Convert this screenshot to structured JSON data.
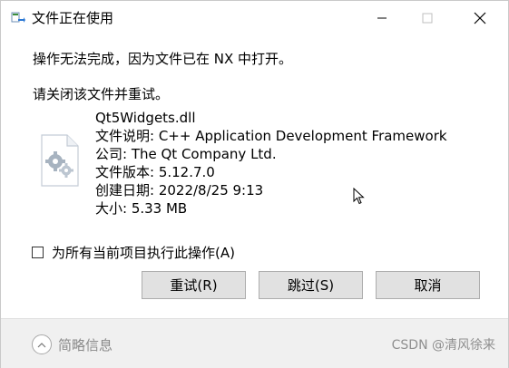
{
  "window": {
    "title": "文件正在使用"
  },
  "message": {
    "line1": "操作无法完成，因为文件已在 NX 中打开。",
    "line2": "请关闭该文件并重试。"
  },
  "file": {
    "name": "Qt5Widgets.dll",
    "description": "文件说明: C++ Application Development Framework",
    "company": "公司: The Qt Company Ltd.",
    "version": "文件版本: 5.12.7.0",
    "created": "创建日期: 2022/8/25 9:13",
    "size": "大小: 5.33 MB"
  },
  "checkbox": {
    "label": "为所有当前项目执行此操作(A)"
  },
  "buttons": {
    "retry": "重试(R)",
    "skip": "跳过(S)",
    "cancel": "取消"
  },
  "footer": {
    "details_label": "简略信息",
    "watermark": "CSDN @清风徐来"
  },
  "icons": {
    "title_icon": "file-move-icon",
    "file_icon": "dll-file-icon",
    "chevron": "chevron-up-icon"
  }
}
